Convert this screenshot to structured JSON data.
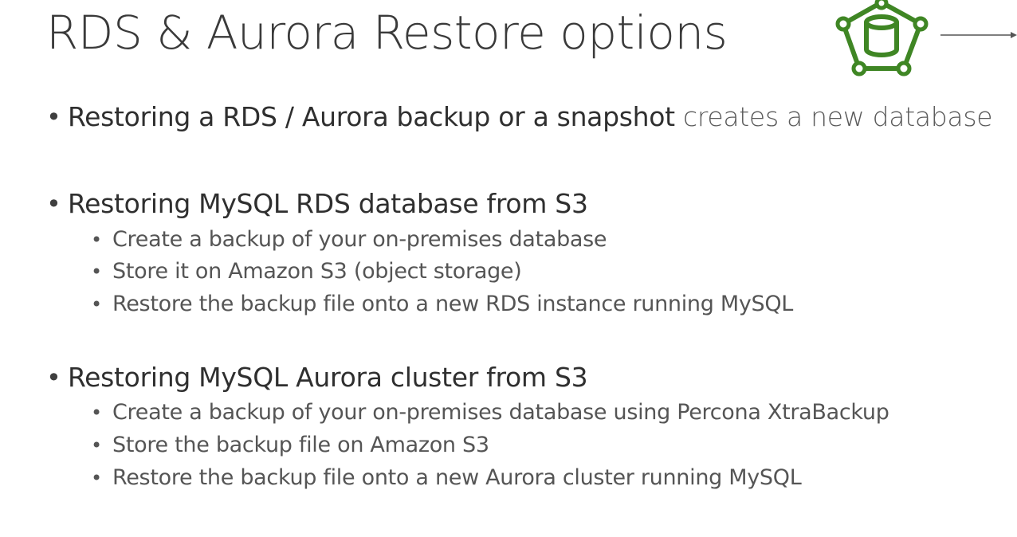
{
  "slide": {
    "title": "RDS & Aurora Restore options"
  },
  "bullets": [
    {
      "emph": "Restoring a RDS / Aurora backup or a snapshot",
      "normal": " creates a new database",
      "subitems": []
    },
    {
      "emph": "Restoring MySQL RDS database from S3",
      "normal": "",
      "subitems": [
        "Create a backup of your on-premises database",
        "Store it on Amazon S3 (object storage)",
        "Restore the backup file onto a new RDS instance running MySQL"
      ]
    },
    {
      "emph": "Restoring MySQL Aurora cluster from S3",
      "normal": "",
      "subitems": [
        "Create a backup of your on-premises database using Percona XtraBackup",
        "Store the backup file on Amazon S3",
        "Restore the backup file onto a new Aurora cluster running MySQL"
      ]
    }
  ],
  "icons": {
    "logo": "aurora-database-icon",
    "arrow": "arrow-right-icon"
  },
  "colors": {
    "aurora_green": "#3f8624",
    "text_dark": "#3a3a3a",
    "text_sub": "#555555"
  }
}
